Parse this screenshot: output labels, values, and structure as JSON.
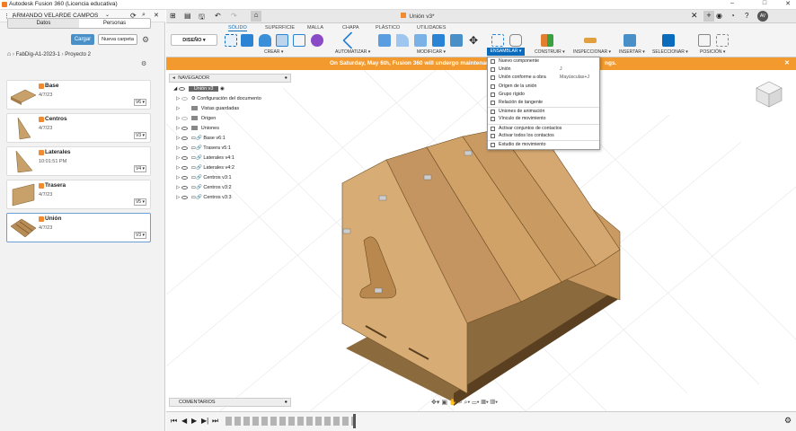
{
  "window": {
    "title": "Autodesk Fusion 360 (Licencia educativa)",
    "doc_title": "Unión v3*"
  },
  "left_panel": {
    "user": "ARMANDO VELARDE CAMPOS",
    "tabs": [
      "Datos",
      "Personas"
    ],
    "load_button": "Cargar",
    "new_folder_button": "Nueva carpeta",
    "breadcrumb": [
      "FabDig-A1-2023-1",
      "Proyecto 2"
    ],
    "files": [
      {
        "name": "Base",
        "date": "4/7/23",
        "version": "V6"
      },
      {
        "name": "Centros",
        "date": "4/7/23",
        "version": "V3"
      },
      {
        "name": "Laterales",
        "date": "10:01:51 PM",
        "version": "V4"
      },
      {
        "name": "Trasera",
        "date": "4/7/23",
        "version": "V5"
      },
      {
        "name": "Unión",
        "date": "4/7/23",
        "version": "V3"
      }
    ]
  },
  "ribbon": {
    "workspace": "DISEÑO",
    "tabs": [
      "SÓLIDO",
      "SUPERFICIE",
      "MALLA",
      "CHAPA",
      "PLÁSTICO",
      "UTILIDADES"
    ],
    "groups": [
      "CREAR",
      "AUTOMATIZAR",
      "MODIFICAR",
      "ENSAMBLAR",
      "CONSTRUIR",
      "INSPECCIONAR",
      "INSERTAR",
      "SELECCIONAR",
      "POSICIÓN"
    ]
  },
  "banner": {
    "text": "On Saturday, May 6th, Fusion 360 will undergo maintenance",
    "text_tail": "ngs."
  },
  "browser": {
    "title": "NAVEGADOR",
    "root": "Unión v3",
    "items": [
      "Configuración del documento",
      "Vistas guardadas",
      "Origen",
      "Uniones",
      "Base v6:1",
      "Trasera v5:1",
      "Laterales v4:1",
      "Laterales v4:2",
      "Centros v3:1",
      "Centros v3:2",
      "Centros v3:3"
    ]
  },
  "comments": "COMENTARIOS",
  "menu": {
    "items": [
      {
        "label": "Nuevo componente",
        "shortcut": ""
      },
      {
        "label": "Unión",
        "shortcut": "J"
      },
      {
        "label": "Unión conforme a obra",
        "shortcut": "Mayúsculas+J"
      },
      {
        "label": "Origen de la unión",
        "shortcut": ""
      },
      {
        "label": "Grupo rígido",
        "shortcut": ""
      },
      {
        "label": "Relación de tangente",
        "shortcut": ""
      },
      {
        "label": "Uniones de animación",
        "shortcut": ""
      },
      {
        "label": "Vínculo de movimiento",
        "shortcut": ""
      },
      {
        "label": "Activar conjuntos de contactos",
        "shortcut": ""
      },
      {
        "label": "Activar todos los contactos",
        "shortcut": ""
      },
      {
        "label": "Estudio de movimiento",
        "shortcut": ""
      }
    ]
  },
  "user_avatar": "AV",
  "accent": "#0a6bbd",
  "banner_color": "#f29a2e"
}
